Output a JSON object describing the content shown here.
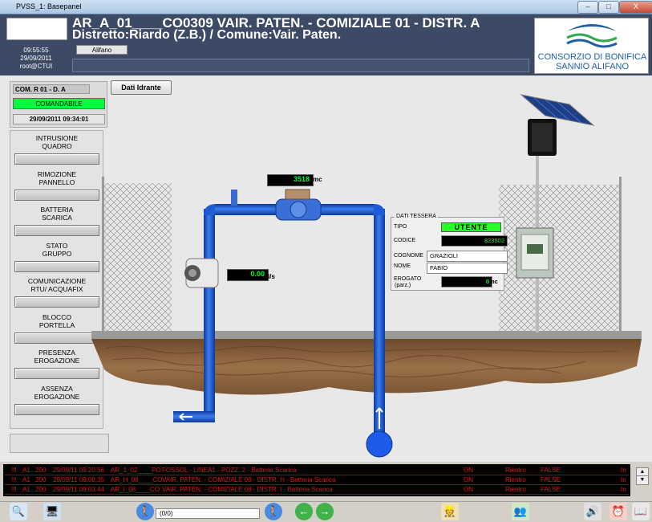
{
  "window": {
    "title": "PVSS_1: Basepanel",
    "btn_min": "–",
    "btn_max": "□",
    "btn_close": "X"
  },
  "header": {
    "title_line1": "AR_A_01____CO0309 VAIR. PATEN. - COMIZIALE 01 - DISTR. A",
    "title_line2": "Distretto:Riardo (Z.B.)  /  Comune:Vair. Paten.",
    "time": "09:55:55",
    "date": "29/09/2011",
    "user": "root@CTUI",
    "tag": "Alifano",
    "logo_line1": "CONSORZIO DI BONIFICA",
    "logo_line2": "SANNIO ALIFANO"
  },
  "command": {
    "label": "COM. R 01 - D. A",
    "status": "COMANDABILE",
    "datetime": "29/09/2011 09:34:01",
    "dati_button": "Dati Idrante"
  },
  "alarms": [
    {
      "l1": "INTRUSIONE",
      "l2": "QUADRO"
    },
    {
      "l1": "RIMOZIONE",
      "l2": "PANNELLO"
    },
    {
      "l1": "BATTERIA",
      "l2": "SCARICA"
    },
    {
      "l1": "STATO",
      "l2": "GRUPPO"
    },
    {
      "l1": "COMUNICAZIONE",
      "l2": "RTU/ ACQUAFIX"
    },
    {
      "l1": "BLOCCO",
      "l2": "PORTELLA"
    },
    {
      "l1": "PRESENZA",
      "l2": "EROGAZIONE"
    },
    {
      "l1": "ASSENZA",
      "l2": "EROGAZIONE"
    }
  ],
  "meters": {
    "volume_value": "3518",
    "volume_unit": "mc",
    "flow_value": "0.00",
    "flow_unit": "l/s"
  },
  "tessera": {
    "title": "DATI TESSERA",
    "tipo_label": "TIPO",
    "tipo_value": "UTENTE",
    "codice_label": "CODICE",
    "codice_value": "823502",
    "cognome_label": "COGNOME",
    "cognome_value": "GRAZIOLI",
    "nome_label": "NOME",
    "nome_value": "FABIO",
    "erogato_label": "EROGATO",
    "erogato_sub": "(parz.)",
    "erogato_value": "0",
    "erogato_unit": "mc"
  },
  "events": [
    {
      "flag": "!!!",
      "a": "A1",
      "b": "200",
      "time": "29/09/11 09:20:56",
      "code": "AR_1_02____PO",
      "desc": "FOSSOL - LINEA1 - POZZ. 2 - Batteria Scarica",
      "state": "ON",
      "type": "Rientro",
      "ack": "FALSE",
      "x": "In"
    },
    {
      "flag": "!!!",
      "a": "A1",
      "b": "200",
      "time": "29/09/11 09:08:35",
      "code": "AR_H_08____CO",
      "desc": "VAIR. PATEN. - COMIZIALE 08 - DISTR. H - Batteria Scarica",
      "state": "ON",
      "type": "Rientro",
      "ack": "FALSE",
      "x": "In"
    },
    {
      "flag": "!!!",
      "a": "A1",
      "b": "200",
      "time": "29/09/11 09:03:44",
      "code": "AR_I_08____CO",
      "desc": "VAIR. PATEN. - COMIZIALE 08 - DISTR. I - Batteria Scarica",
      "state": "ON",
      "type": "Rientro",
      "ack": "FALSE",
      "x": "In"
    }
  ],
  "toolbar": {
    "pager": "(0/0)"
  },
  "colors": {
    "header_bg": "#3c4a66",
    "ok_green": "#00ff3a",
    "pipe_blue": "#1f5bd6",
    "alarm_red": "#e01818"
  }
}
